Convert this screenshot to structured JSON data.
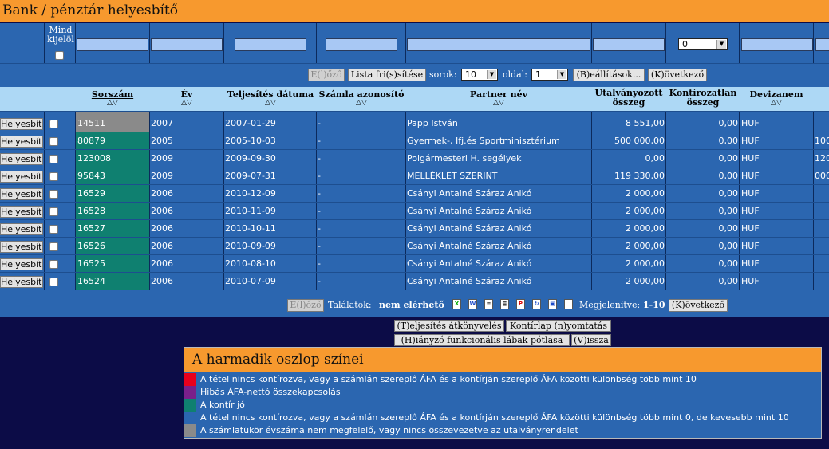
{
  "app_title": "Bank / pénztár helyesbítő",
  "filter": {
    "mind_kijelol_label": "Mind kijelöl",
    "devizanem_select": "0"
  },
  "pager": {
    "prev_label": "E(l)őző",
    "refresh_label": "Lista fri(s)sítése",
    "rows_label": "sorok:",
    "rows_value": "10",
    "page_label": "oldal:",
    "page_value": "1",
    "settings_label": "(B)eállítások...",
    "next_label": "(K)övetkező"
  },
  "columns": {
    "sorszam": "Sorszám",
    "ev": "Év",
    "teljesites": "Teljesítés dátuma",
    "szamla": "Számla azonosító",
    "partner": "Partner név",
    "utalvanyozott": "Utalványozott összeg",
    "kontirozatlan": "Kontírozatlan összeg",
    "devizanem": "Devizanem",
    "sort_glyph": "△▽"
  },
  "row_button_label": "Helyesbít",
  "rows": [
    {
      "sorszam": "14511",
      "ev": "2007",
      "datum": "2007-01-29",
      "szamla": "-",
      "partner": "Papp István",
      "utalv": "8 551,00",
      "kontir": "0,00",
      "deviza": "HUF",
      "extra": "",
      "color": "#8a8a8a"
    },
    {
      "sorszam": "80879",
      "ev": "2005",
      "datum": "2005-10-03",
      "szamla": "-",
      "partner": "Gyermek-, Ifj.és Sportminisztérium",
      "utalv": "500 000,00",
      "kontir": "0,00",
      "deviza": "HUF",
      "extra": "100",
      "color": "#0f8070"
    },
    {
      "sorszam": "123008",
      "ev": "2009",
      "datum": "2009-09-30",
      "szamla": "-",
      "partner": "Polgármesteri H. segélyek",
      "utalv": "0,00",
      "kontir": "0,00",
      "deviza": "HUF",
      "extra": "120",
      "color": "#0f8070"
    },
    {
      "sorszam": "95843",
      "ev": "2009",
      "datum": "2009-07-31",
      "szamla": "-",
      "partner": "MELLÉKLET SZERINT",
      "utalv": "119 330,00",
      "kontir": "0,00",
      "deviza": "HUF",
      "extra": "000",
      "color": "#0f8070"
    },
    {
      "sorszam": "16529",
      "ev": "2006",
      "datum": "2010-12-09",
      "szamla": "-",
      "partner": "Csányi Antalné Száraz Anikó",
      "utalv": "2 000,00",
      "kontir": "0,00",
      "deviza": "HUF",
      "extra": "",
      "color": "#0f8070"
    },
    {
      "sorszam": "16528",
      "ev": "2006",
      "datum": "2010-11-09",
      "szamla": "-",
      "partner": "Csányi Antalné Száraz Anikó",
      "utalv": "2 000,00",
      "kontir": "0,00",
      "deviza": "HUF",
      "extra": "",
      "color": "#0f8070"
    },
    {
      "sorszam": "16527",
      "ev": "2006",
      "datum": "2010-10-11",
      "szamla": "-",
      "partner": "Csányi Antalné Száraz Anikó",
      "utalv": "2 000,00",
      "kontir": "0,00",
      "deviza": "HUF",
      "extra": "",
      "color": "#0f8070"
    },
    {
      "sorszam": "16526",
      "ev": "2006",
      "datum": "2010-09-09",
      "szamla": "-",
      "partner": "Csányi Antalné Száraz Anikó",
      "utalv": "2 000,00",
      "kontir": "0,00",
      "deviza": "HUF",
      "extra": "",
      "color": "#0f8070"
    },
    {
      "sorszam": "16525",
      "ev": "2006",
      "datum": "2010-08-10",
      "szamla": "-",
      "partner": "Csányi Antalné Száraz Anikó",
      "utalv": "2 000,00",
      "kontir": "0,00",
      "deviza": "HUF",
      "extra": "",
      "color": "#0f8070"
    },
    {
      "sorszam": "16524",
      "ev": "2006",
      "datum": "2010-07-09",
      "szamla": "-",
      "partner": "Csányi Antalné Száraz Anikó",
      "utalv": "2 000,00",
      "kontir": "0,00",
      "deviza": "HUF",
      "extra": "",
      "color": "#0f8070"
    }
  ],
  "footer": {
    "prev_label": "E(l)őző",
    "talalatok_label": "Találatok:",
    "talalatok_value": "nem elérhető",
    "megjelenitve_label": "Megjelenítve:",
    "megjelenitve_value": "1-10",
    "next_label": "(K)övetkező",
    "export_icons": [
      "excel-icon",
      "word-icon",
      "text-icon",
      "list-icon",
      "pdf-icon",
      "refresh-doc-icon",
      "image-icon",
      "blank-doc-icon"
    ]
  },
  "actions": {
    "teljesites": "(T)eljesítés átkönyvelés",
    "kontirlap": "Kontírlap (n)yomtatás",
    "hianyzo": "(H)iányzó funkcionális lábak pótlása",
    "vissza": "(V)issza"
  },
  "legend": {
    "title": "A harmadik oszlop színei",
    "items": [
      {
        "color": "#e8001c",
        "text": "A tétel nincs kontírozva, vagy a számlán szereplő ÁFA és a kontírján szereplő ÁFA közötti különbség több mint 10"
      },
      {
        "color": "#7a1f8a",
        "text": "Hibás ÁFA-nettó összekapcsolás"
      },
      {
        "color": "#0f8070",
        "text": "A kontír jó"
      },
      {
        "color": "#2b66b0",
        "text": "A tétel nincs kontírozva, vagy a számlán szereplő ÁFA és a kontírján szereplő ÁFA közötti különbség több mint 0, de kevesebb mint 10"
      },
      {
        "color": "#8a8a8a",
        "text": "A számlatükör évszáma nem megfelelő, vagy nincs összevezetve az utalványrendelet"
      }
    ]
  }
}
